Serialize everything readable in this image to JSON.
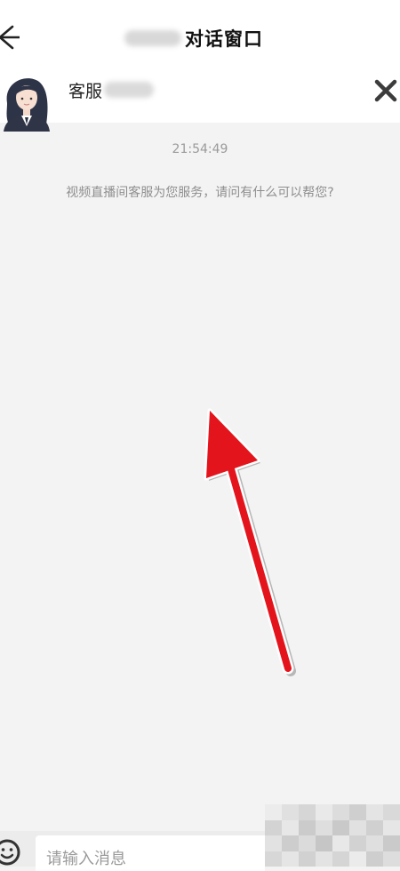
{
  "header": {
    "title": "对话窗口"
  },
  "agent": {
    "name": "客服"
  },
  "chat": {
    "timestamp": "21:54:49",
    "system_message": "视频直播间客服为您服务，请问有什么可以帮您?"
  },
  "input": {
    "placeholder": "请输入消息"
  },
  "colors": {
    "background": "#f3f3f4",
    "header_bg": "#ffffff",
    "annotation_arrow": "#e3141c"
  },
  "icons": {
    "back": "back-arrow-icon",
    "close": "close-icon",
    "emoji": "emoji-icon"
  }
}
